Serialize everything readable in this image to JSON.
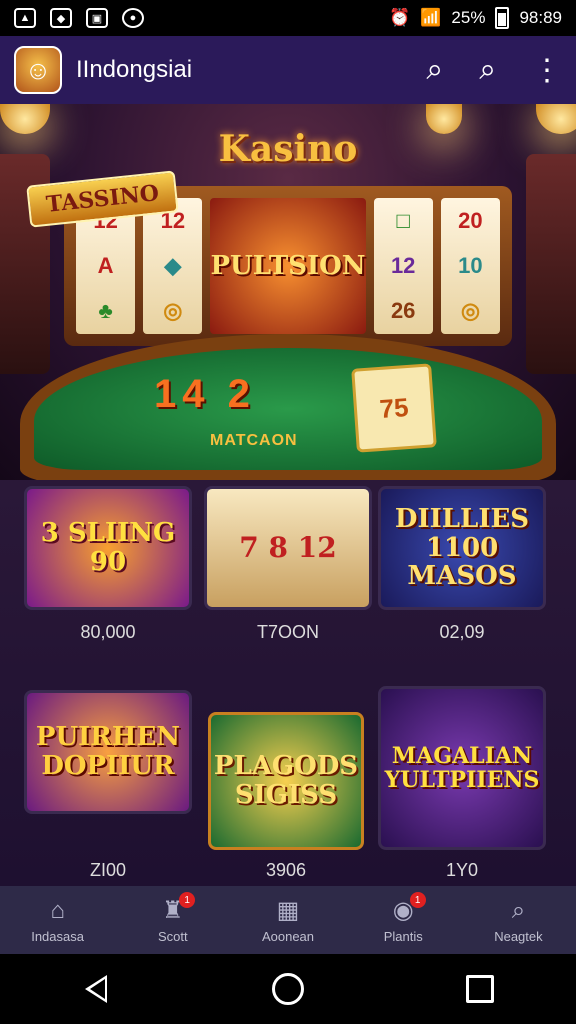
{
  "status_bar": {
    "left_icons": [
      "image-icon",
      "shield-icon",
      "photo-icon",
      "chat-icon"
    ],
    "battery_text": "25%",
    "time": "98:89"
  },
  "app_bar": {
    "title": "IIndongsiai",
    "logo_icon": "character-logo-icon",
    "actions": [
      "search-icon",
      "search-icon",
      "more-vert-icon"
    ]
  },
  "hero": {
    "title": "Kasino",
    "badge": "TASSINO",
    "reels": [
      [
        "12",
        "A",
        "♣"
      ],
      [
        "12",
        "◆",
        "◎"
      ],
      [
        "PULTSION"
      ],
      [
        "□",
        "12",
        "26"
      ],
      [
        "20",
        "10",
        "◎"
      ]
    ],
    "table_numbers": "14  2",
    "table_label": "MATCAON",
    "card_value": "75"
  },
  "games": {
    "tiles": [
      {
        "text": "3 SLIING 90",
        "caption": "80,000"
      },
      {
        "text": "7 8 12",
        "caption": "T7OON"
      },
      {
        "text": "DIILLIES 1100 MASOS",
        "caption": "02,09"
      },
      {
        "text": "PUIRHEN DOPIIUR",
        "caption": "ZI00"
      },
      {
        "text": "PLAGODS SIGISS",
        "caption": "3906"
      },
      {
        "text": "MAGALIAN YULTPIIENS",
        "caption": "1Y0"
      }
    ]
  },
  "bottom_nav": [
    {
      "label": "Indasasa",
      "icon": "home-icon",
      "badge": ""
    },
    {
      "label": "Scott",
      "icon": "piggy-bank-icon",
      "badge": "1"
    },
    {
      "label": "Aoonean",
      "icon": "box-icon",
      "badge": ""
    },
    {
      "label": "Plantis",
      "icon": "chip-icon",
      "badge": "1"
    },
    {
      "label": "Neagtek",
      "icon": "search-icon",
      "badge": ""
    }
  ],
  "colors": {
    "app_bar": "#2b1a5a",
    "accent_gold": "#f8c040",
    "felt_green": "#1a7a3a"
  }
}
